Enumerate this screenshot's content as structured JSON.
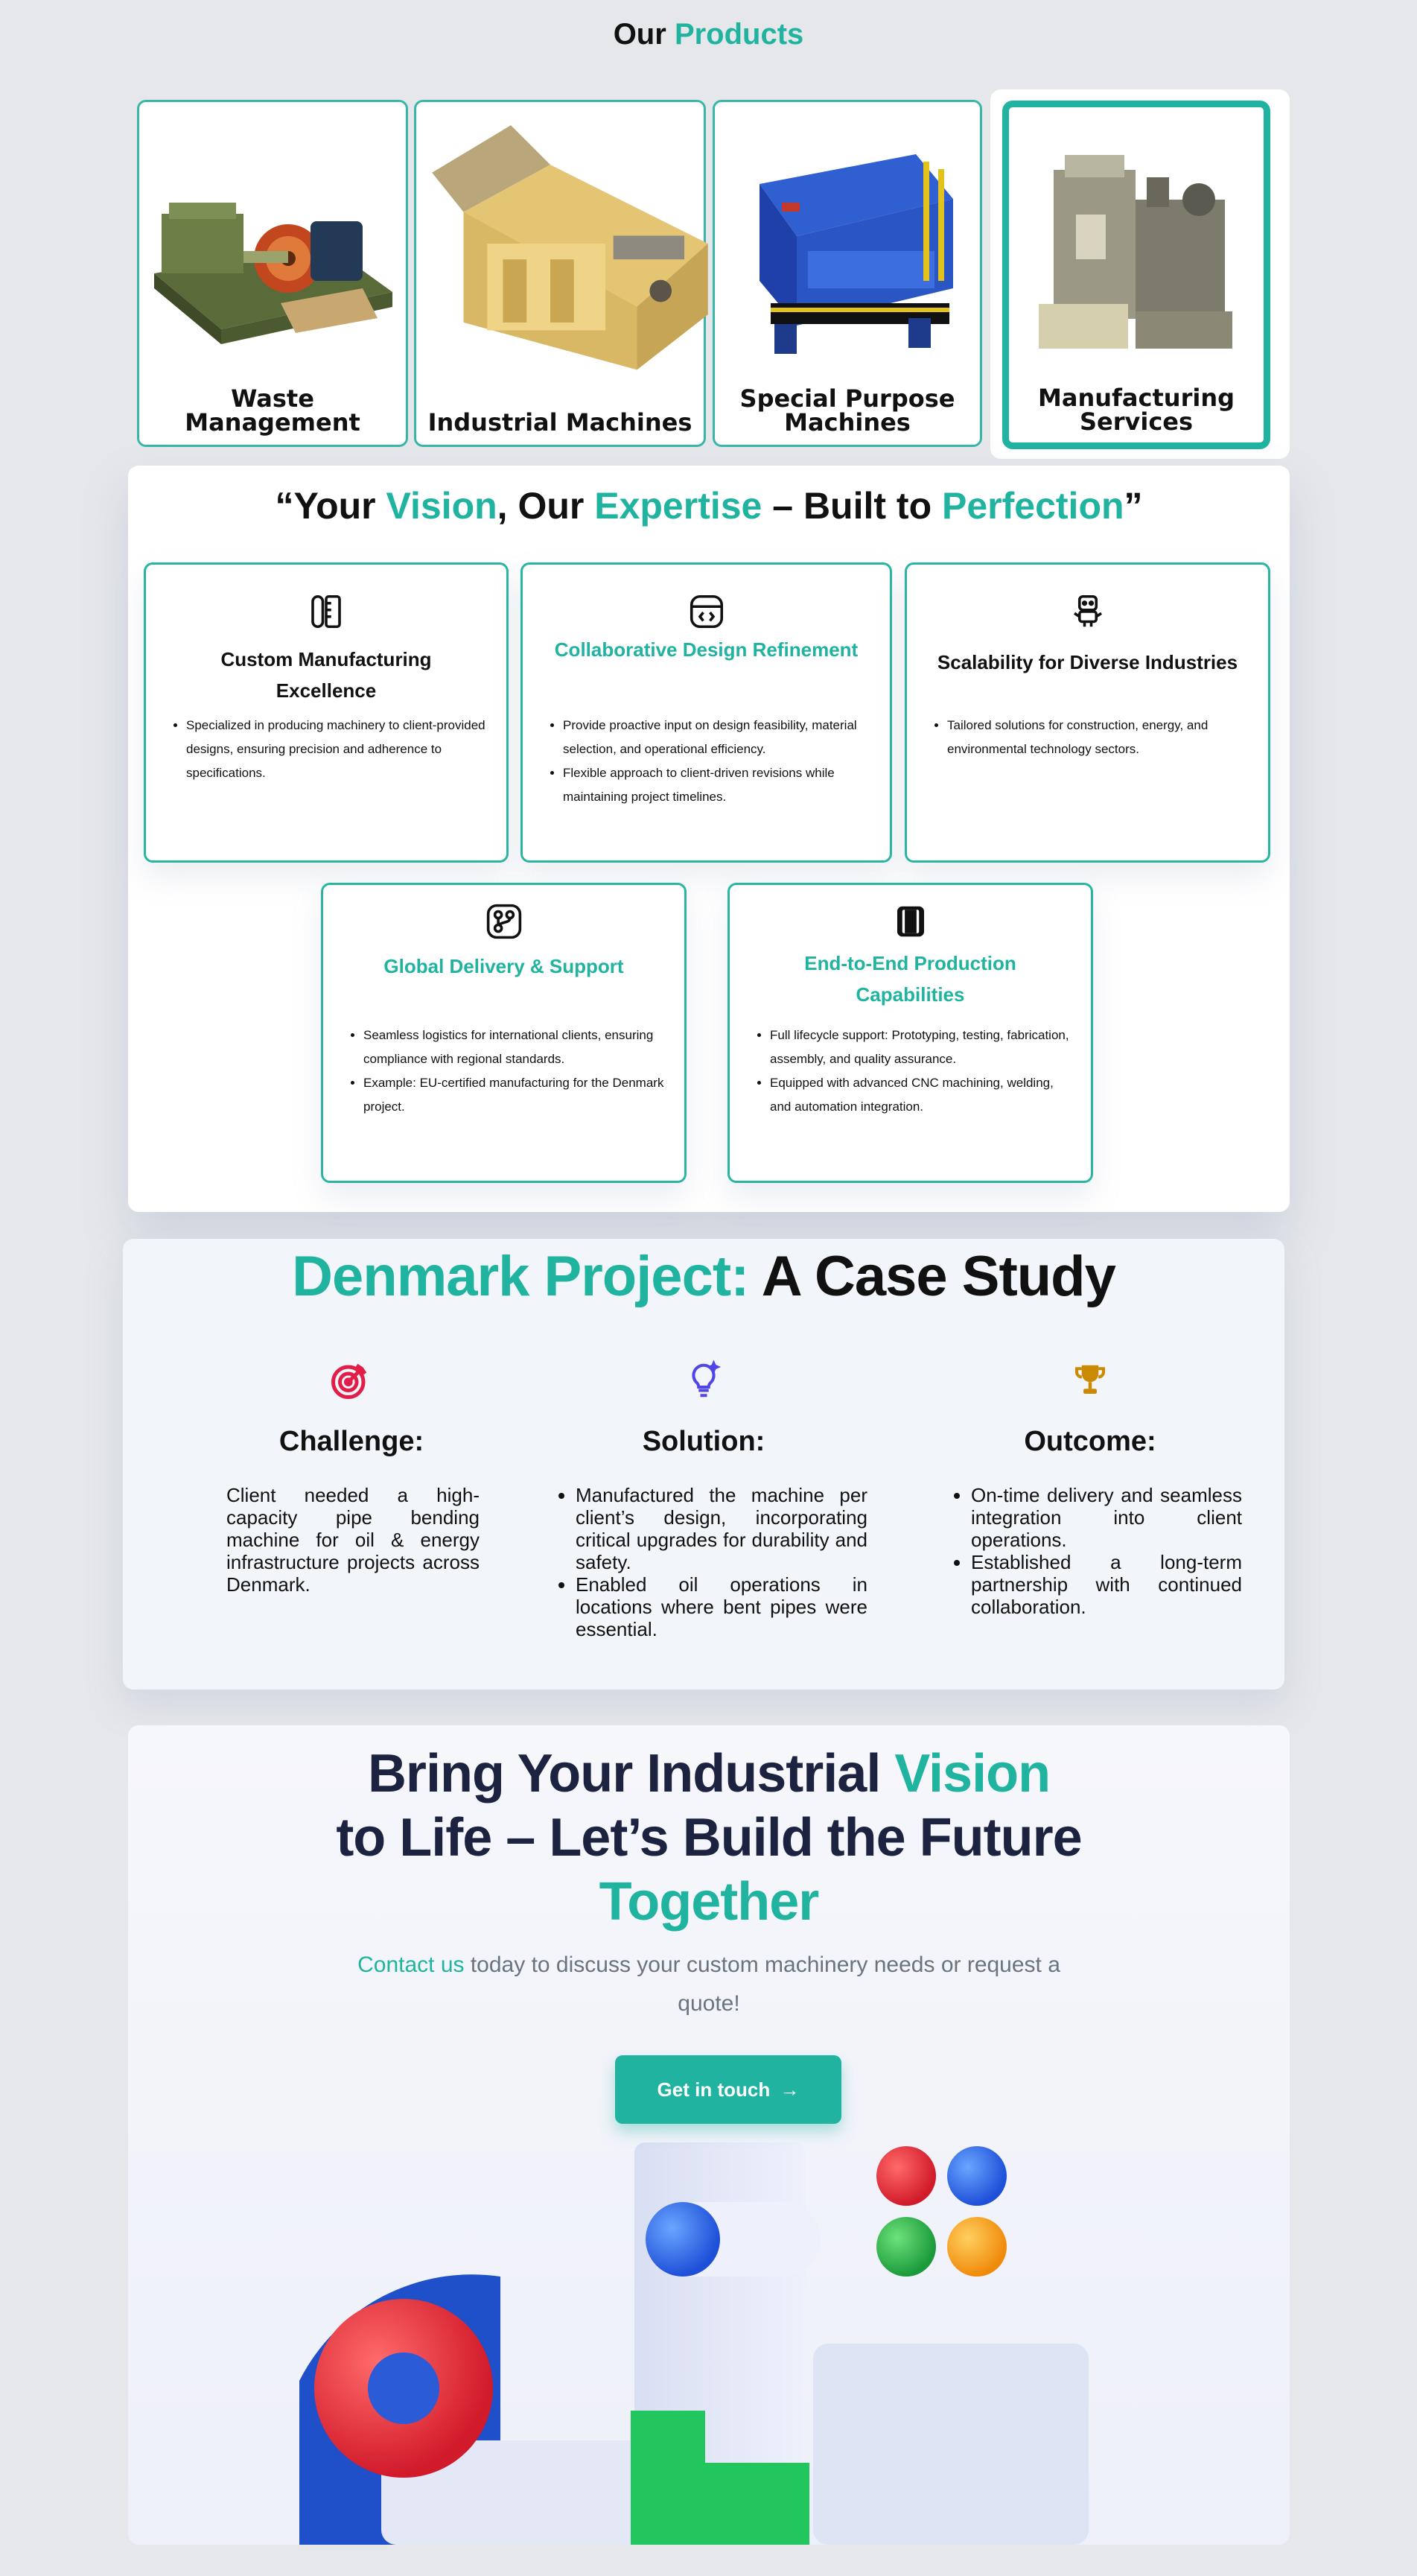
{
  "products": {
    "title_prefix": "Our",
    "title_highlight": "Products",
    "items": [
      {
        "name": "Waste Management",
        "image": "pipe-bending-machine"
      },
      {
        "name": "Industrial Machines",
        "image": "baler-machine"
      },
      {
        "name": "Special Purpose Machines",
        "image": "shredder-machine"
      },
      {
        "name": "Manufacturing Services",
        "image": "manufacturing-unit",
        "selected": true
      }
    ]
  },
  "features": {
    "title": {
      "open_quote": "“Your ",
      "w1": "Vision",
      "mid1": ", Our ",
      "w2": "Expertise",
      "mid2": " – Built to ",
      "w3": "Perfection",
      "close": "”"
    },
    "cards": [
      {
        "icon": "ruler-pencil-icon",
        "title": "Custom Manufacturing Excellence",
        "highlight": false,
        "bullets": [
          "Specialized in producing machinery to client-provided designs, ensuring precision and adherence to specifications."
        ]
      },
      {
        "icon": "code-browser-icon",
        "title": "Collaborative Design Refinement",
        "highlight": true,
        "bullets": [
          "Provide proactive input on design feasibility, material selection, and operational efficiency.",
          "Flexible approach to client-driven revisions while maintaining project timelines."
        ]
      },
      {
        "icon": "robot-icon",
        "title": "Scalability for Diverse Industries",
        "highlight": false,
        "bullets": [
          "Tailored solutions for construction, energy, and environmental technology sectors."
        ]
      },
      {
        "icon": "git-branch-icon",
        "title": "Global Delivery & Support",
        "highlight": true,
        "bullets": [
          "Seamless logistics for international clients, ensuring compliance with regional standards.",
          "Example: EU-certified manufacturing for the Denmark project."
        ]
      },
      {
        "icon": "book-icon",
        "title": "End-to-End Production Capabilities",
        "highlight": true,
        "bullets": [
          "Full lifecycle support: Prototyping, testing, fabrication, assembly, and quality assurance.",
          "Equipped with advanced CNC machining, welding, and automation integration."
        ]
      }
    ]
  },
  "case_study": {
    "title_highlight": "Denmark Project:",
    "title_rest": "A Case Study",
    "challenge": {
      "icon": "target-icon",
      "heading": "Challenge:",
      "text": "Client needed a high-capacity pipe bending machine for oil & energy infrastructure projects across Denmark."
    },
    "solution": {
      "icon": "lightbulb-icon",
      "heading": "Solution:",
      "bullets": [
        "Manufactured the machine per client’s design, incorporating critical upgrades for durability and safety.",
        "Enabled oil operations in locations where bent pipes were essential."
      ]
    },
    "outcome": {
      "icon": "trophy-icon",
      "heading": "Outcome:",
      "bullets": [
        "On-time delivery and seamless integration into client operations.",
        "Established a long-term partnership with continued collaboration."
      ]
    }
  },
  "cta": {
    "line1_a": "Bring Your Industrial ",
    "line1_b": "Vision",
    "line2": "to Life – Let’s Build the Future",
    "line3": "Together",
    "sub_link": "Contact us",
    "sub_rest": " today to discuss your custom machinery needs or request a quote!",
    "button_label": "Get in touch",
    "button_icon": "arrow-right-icon"
  },
  "colors": {
    "accent": "#1fb3a0",
    "dark": "#1b2340",
    "target": "#e11d48",
    "bulb": "#4f46e5",
    "trophy": "#ca8a04"
  }
}
